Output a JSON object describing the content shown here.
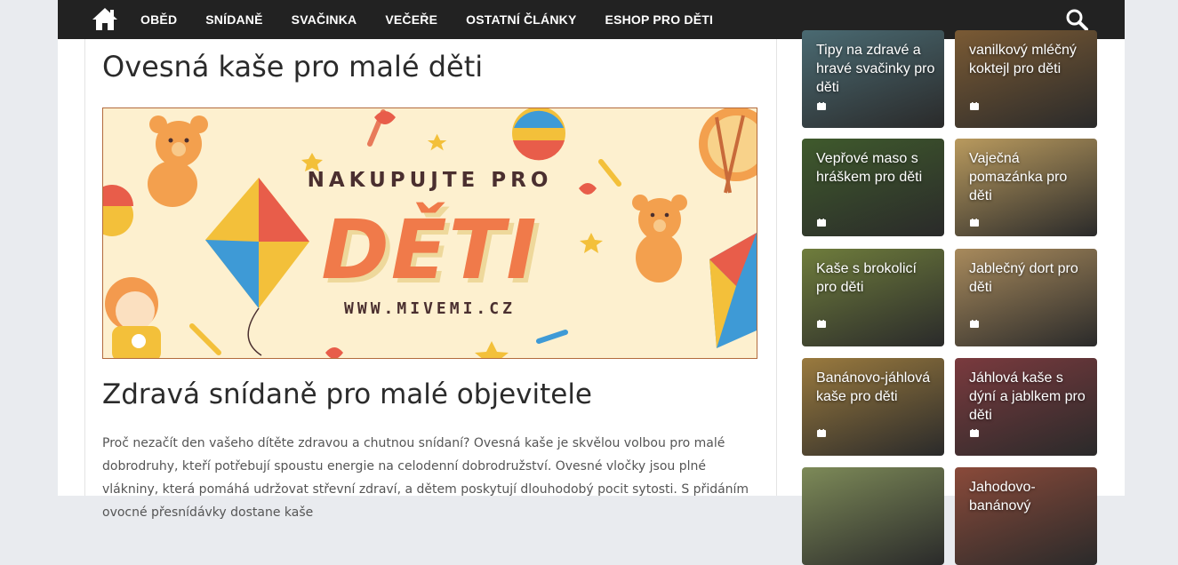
{
  "nav": {
    "items": [
      "OBĚD",
      "SNÍDANĚ",
      "SVAČINKA",
      "VEČEŘE",
      "OSTATNÍ ČLÁNKY",
      "ESHOP PRO DĚTI"
    ]
  },
  "article": {
    "title": "Ovesná kaše pro malé děti",
    "banner": {
      "line1": "NAKUPUJTE PRO",
      "line2": "DĚTI",
      "line3": "WWW.MIVEMI.CZ"
    },
    "subtitle": "Zdravá snídaně pro malé objevitele",
    "paragraph": "Proč nezačít den vašeho dítěte zdravou a chutnou snídaní? Ovesná kaše je skvělou volbou pro malé dobrodruhy, kteří potřebují spoustu energie na celodenní dobrodružství. Ovesné vločky jsou plné vlákniny, která pomáhá udržovat střevní zdraví, a dětem poskytují dlouhodobý pocit sytosti. S přidáním ovocné přesnídávky dostane kaše"
  },
  "sidebar": {
    "cards": [
      {
        "title": "Tipy na zdravé a hravé svačinky pro děti",
        "bg": "#4a6a72"
      },
      {
        "title": "vanilkový mléčný koktejl pro děti",
        "bg": "#7a5a34"
      },
      {
        "title": "Vepřové maso s hráškem pro děti",
        "bg": "#3f5a2c"
      },
      {
        "title": "Vaječná pomazánka pro děti",
        "bg": "#b99a5e"
      },
      {
        "title": "Kaše s brokolicí pro děti",
        "bg": "#6f7d3c"
      },
      {
        "title": "Jablečný dort pro děti",
        "bg": "#a88a5c"
      },
      {
        "title": "Banánovo-jáhlová kaše pro děti",
        "bg": "#9a7a3e"
      },
      {
        "title": "Jáhlová kaše s dýní a jablkem pro děti",
        "bg": "#7a3a3e"
      },
      {
        "title": "",
        "bg": "#7d8a58"
      },
      {
        "title": "Jahodovo-banánový",
        "bg": "#8a4a3a"
      }
    ]
  }
}
